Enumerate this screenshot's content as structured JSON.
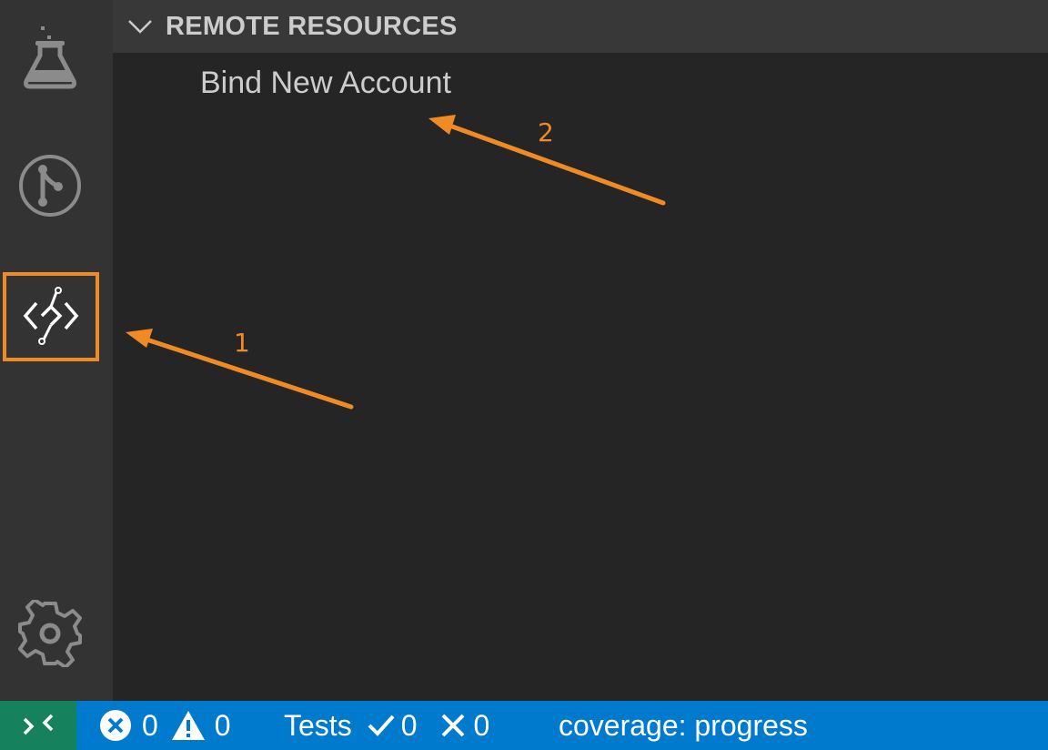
{
  "activity_bar": {
    "items": [
      {
        "name": "test-explorer",
        "icon": "flask-icon"
      },
      {
        "name": "source-control",
        "icon": "git-branch-icon"
      },
      {
        "name": "remote-resources",
        "icon": "remote-resources-icon",
        "highlighted": true
      },
      {
        "name": "settings",
        "icon": "gear-icon"
      }
    ]
  },
  "sidebar": {
    "section_title": "REMOTE RESOURCES",
    "items": [
      {
        "label": "Bind New Account"
      }
    ]
  },
  "statusbar": {
    "remote_icon": "remote-icon",
    "errors": "0",
    "warnings": "0",
    "tests_label": "Tests",
    "tests_passed": "0",
    "tests_failed": "0",
    "coverage": "coverage: progress"
  },
  "annotations": [
    {
      "label": "1"
    },
    {
      "label": "2"
    }
  ],
  "colors": {
    "activity_bar": "#333333",
    "sidebar": "#252526",
    "section_header": "#383838",
    "statusbar": "#007acc",
    "remote_button": "#16825d",
    "annotation": "#f08a24",
    "text": "#cccccc"
  }
}
